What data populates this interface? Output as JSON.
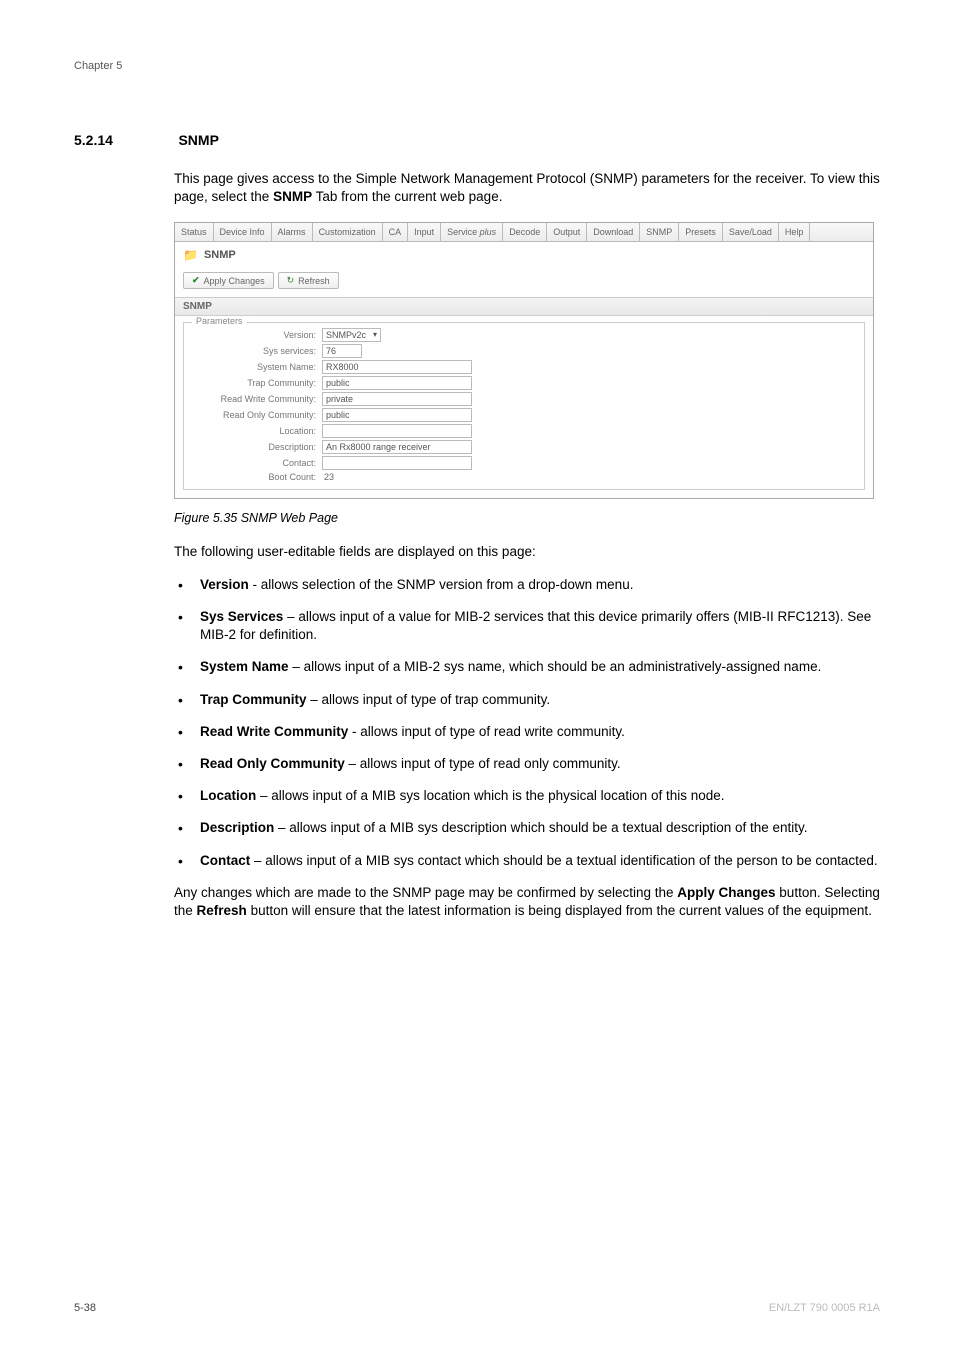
{
  "header": {
    "chapter": "Chapter 5"
  },
  "heading": {
    "num": "5.2.14",
    "title": "SNMP"
  },
  "intro": {
    "p1a": "This page gives access to the Simple Network Management Protocol (SNMP) parameters for the receiver. To view this page, select the ",
    "p1b": "SNMP",
    "p1c": " Tab from the current web page."
  },
  "screenshot": {
    "tabs": [
      "Status",
      "Device Info",
      "Alarms",
      "Customization",
      "CA",
      "Input",
      "Service",
      "plus",
      "Decode",
      "Output",
      "Download",
      "SNMP",
      "Presets",
      "Save/Load",
      "Help"
    ],
    "panel_title": "SNMP",
    "btn_apply": "Apply Changes",
    "btn_refresh": "Refresh",
    "section": "SNMP",
    "fieldset": "Parameters",
    "rows": {
      "version": {
        "label": "Version:",
        "value": "SNMPv2c"
      },
      "sys_services": {
        "label": "Sys services:",
        "value": "76"
      },
      "system_name": {
        "label": "System Name:",
        "value": "RX8000"
      },
      "trap_community": {
        "label": "Trap Community:",
        "value": "public"
      },
      "rw_community": {
        "label": "Read Write Community:",
        "value": "private"
      },
      "ro_community": {
        "label": "Read Only Community:",
        "value": "public"
      },
      "location": {
        "label": "Location:",
        "value": ""
      },
      "description": {
        "label": "Description:",
        "value": "An Rx8000 range receiver"
      },
      "contact": {
        "label": "Contact:",
        "value": ""
      },
      "boot_count": {
        "label": "Boot Count:",
        "value": "23"
      }
    }
  },
  "caption": "Figure 5.35 SNMP Web Page",
  "body": {
    "lead": "The following user-editable fields are displayed on this page:",
    "bullets": [
      {
        "b": "Version",
        "t": " - allows selection of the SNMP version from a drop-down menu."
      },
      {
        "b": "Sys Services",
        "t": " – allows input of a value for MIB-2 services that this device primarily offers (MIB-II RFC1213). See MIB-2 for definition."
      },
      {
        "b": "System Name",
        "t": " – allows input of a MIB-2 sys name, which should be an administratively-assigned name."
      },
      {
        "b": "Trap Community",
        "t": " – allows input of type of trap community."
      },
      {
        "b": "Read Write Community",
        "t": " - allows input of type of read write community."
      },
      {
        "b": "Read Only Community",
        "t": " – allows input of type of read only community."
      },
      {
        "b": "Location",
        "t": " – allows input of a MIB sys location which is the physical location of this node."
      },
      {
        "b": "Description",
        "t": " – allows input of a MIB sys description which should be a textual description of the entity."
      },
      {
        "b": "Contact",
        "t": " – allows input of a MIB sys contact which should be a textual identification of the person to be contacted."
      }
    ],
    "tail_a": "Any changes which are made to the SNMP page may be confirmed by selecting the ",
    "tail_b": "Apply Changes",
    "tail_c": " button. Selecting the ",
    "tail_d": "Refresh",
    "tail_e": " button will ensure that the latest information is being displayed from the current values of the equipment."
  },
  "footer": {
    "left": "5-38",
    "right": "EN/LZT 790 0005 R1A"
  }
}
